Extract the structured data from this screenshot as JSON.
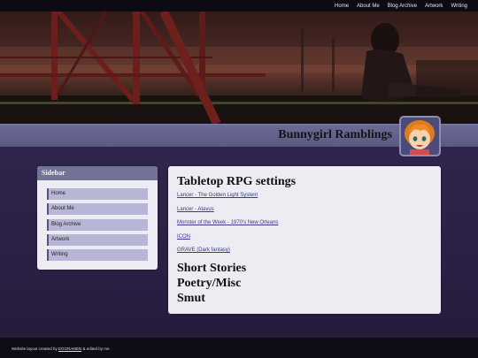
{
  "topnav": {
    "items": [
      "Home",
      "About Me",
      "Blog Archive",
      "Artwork",
      "Writing"
    ]
  },
  "header": {
    "title": "Bunnygirl Ramblings"
  },
  "sidebar": {
    "heading": "Sidebar",
    "items": [
      "Home",
      "About Me",
      "Blog Archive",
      "Artwork",
      "Writing"
    ]
  },
  "main": {
    "heading": "Tabletop RPG settings",
    "links": [
      "Lancer - The Golden Light System",
      "Lancer - Atavus",
      "Monster of the Week - 1970's New Orleans",
      "ICON",
      "GRAVE (Dark fantasy)"
    ],
    "sections": [
      "Short Stories",
      "Poetry/Misc",
      "Smut"
    ]
  },
  "footer": {
    "prefix": "Website layout created by ",
    "link": "EGGRAMEN",
    "suffix": " & edited by me."
  },
  "colors": {
    "accent": "#595983",
    "sidebar_item": "#b8b6d6",
    "link": "#3a3a8a"
  }
}
